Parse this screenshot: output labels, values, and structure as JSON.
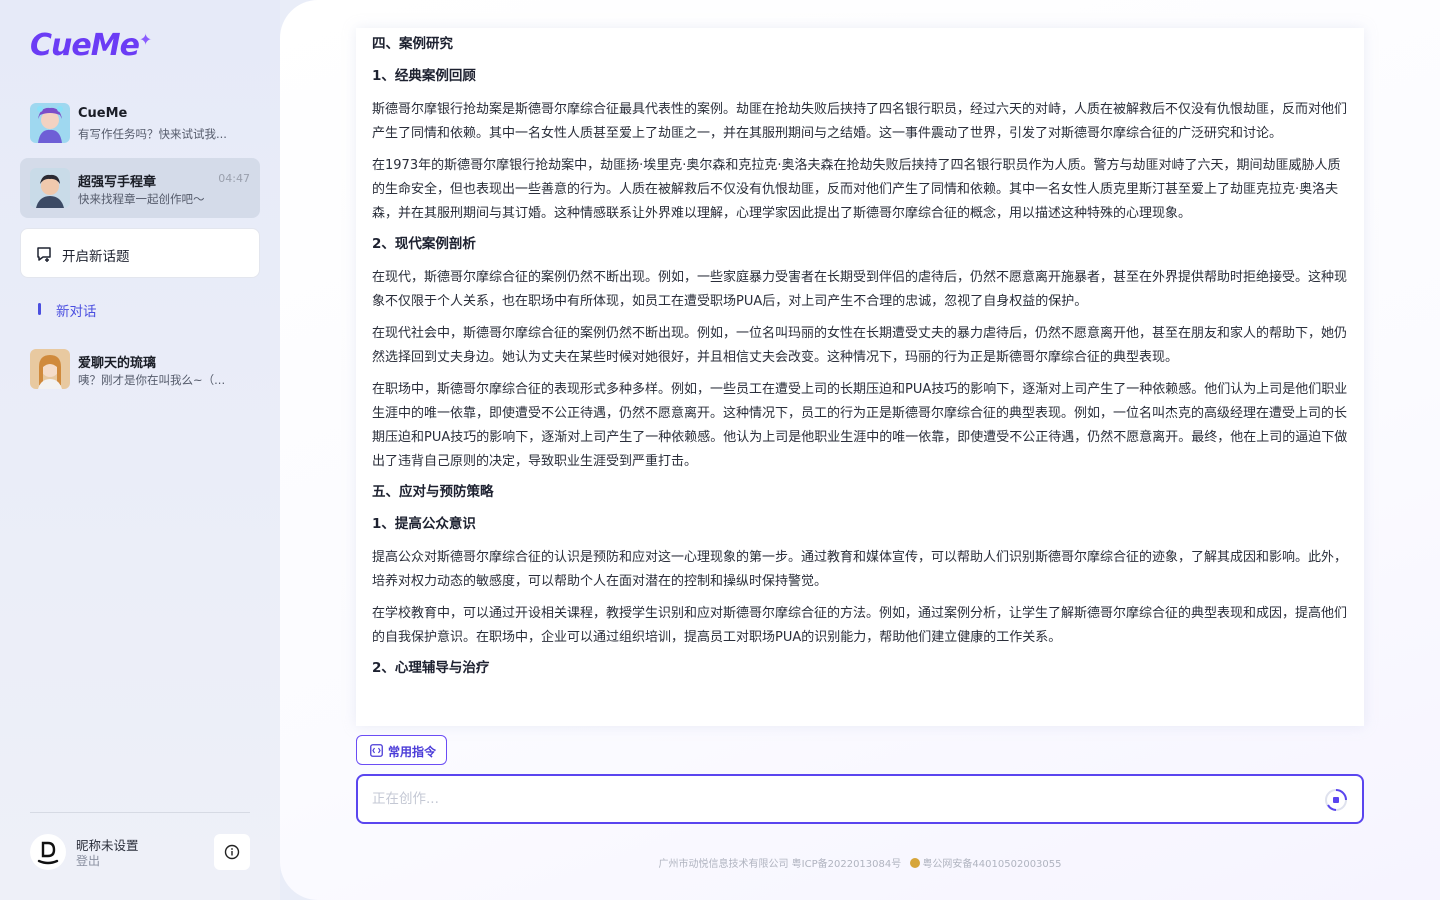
{
  "app": {
    "logo": "CueMe",
    "logo_spark": "✦"
  },
  "sidebar": {
    "chats": [
      {
        "name": "CueMe",
        "subtitle": "有写作任务吗？快来试试我...",
        "time": ""
      },
      {
        "name": "超强写手程章",
        "subtitle": "快来找程章一起创作吧～",
        "time": "04:47"
      }
    ],
    "new_topic_label": "开启新话题",
    "section_label": "新对话",
    "history": [
      {
        "name": "爱聊天的琉璃",
        "subtitle": "咦？刚才是你在叫我么~（..."
      }
    ],
    "user": {
      "name": "昵称未设置",
      "logout": "登出"
    }
  },
  "article": {
    "blocks": [
      {
        "type": "h",
        "text": "四、案例研究"
      },
      {
        "type": "h",
        "text": "1、经典案例回顾"
      },
      {
        "type": "p",
        "text": "斯德哥尔摩银行抢劫案是斯德哥尔摩综合征最具代表性的案例。劫匪在抢劫失败后挟持了四名银行职员，经过六天的对峙，人质在被解救后不仅没有仇恨劫匪，反而对他们产生了同情和依赖。其中一名女性人质甚至爱上了劫匪之一，并在其服刑期间与之结婚。这一事件震动了世界，引发了对斯德哥尔摩综合征的广泛研究和讨论。"
      },
      {
        "type": "p",
        "text": "在1973年的斯德哥尔摩银行抢劫案中，劫匪扬·埃里克·奥尔森和克拉克·奥洛夫森在抢劫失败后挟持了四名银行职员作为人质。警方与劫匪对峙了六天，期间劫匪威胁人质的生命安全，但也表现出一些善意的行为。人质在被解救后不仅没有仇恨劫匪，反而对他们产生了同情和依赖。其中一名女性人质克里斯汀甚至爱上了劫匪克拉克·奥洛夫森，并在其服刑期间与其订婚。这种情感联系让外界难以理解，心理学家因此提出了斯德哥尔摩综合征的概念，用以描述这种特殊的心理现象。"
      },
      {
        "type": "h",
        "text": "2、现代案例剖析"
      },
      {
        "type": "p",
        "text": "在现代，斯德哥尔摩综合征的案例仍然不断出现。例如，一些家庭暴力受害者在长期受到伴侣的虐待后，仍然不愿意离开施暴者，甚至在外界提供帮助时拒绝接受。这种现象不仅限于个人关系，也在职场中有所体现，如员工在遭受职场PUA后，对上司产生不合理的忠诚，忽视了自身权益的保护。"
      },
      {
        "type": "p",
        "text": "在现代社会中，斯德哥尔摩综合征的案例仍然不断出现。例如，一位名叫玛丽的女性在长期遭受丈夫的暴力虐待后，仍然不愿意离开他，甚至在朋友和家人的帮助下，她仍然选择回到丈夫身边。她认为丈夫在某些时候对她很好，并且相信丈夫会改变。这种情况下，玛丽的行为正是斯德哥尔摩综合征的典型表现。"
      },
      {
        "type": "p",
        "text": "在职场中，斯德哥尔摩综合征的表现形式多种多样。例如，一些员工在遭受上司的长期压迫和PUA技巧的影响下，逐渐对上司产生了一种依赖感。他们认为上司是他们职业生涯中的唯一依靠，即使遭受不公正待遇，仍然不愿意离开。这种情况下，员工的行为正是斯德哥尔摩综合征的典型表现。例如，一位名叫杰克的高级经理在遭受上司的长期压迫和PUA技巧的影响下，逐渐对上司产生了一种依赖感。他认为上司是他职业生涯中的唯一依靠，即使遭受不公正待遇，仍然不愿意离开。最终，他在上司的逼迫下做出了违背自己原则的决定，导致职业生涯受到严重打击。"
      },
      {
        "type": "h",
        "text": "五、应对与预防策略"
      },
      {
        "type": "h",
        "text": "1、提高公众意识"
      },
      {
        "type": "p",
        "text": "提高公众对斯德哥尔摩综合征的认识是预防和应对这一心理现象的第一步。通过教育和媒体宣传，可以帮助人们识别斯德哥尔摩综合征的迹象，了解其成因和影响。此外，培养对权力动态的敏感度，可以帮助个人在面对潜在的控制和操纵时保持警觉。"
      },
      {
        "type": "p",
        "text": "在学校教育中，可以通过开设相关课程，教授学生识别和应对斯德哥尔摩综合征的方法。例如，通过案例分析，让学生了解斯德哥尔摩综合征的典型表现和成因，提高他们的自我保护意识。在职场中，企业可以通过组织培训，提高员工对职场PUA的识别能力，帮助他们建立健康的工作关系。"
      },
      {
        "type": "h",
        "text": "2、心理辅导与治疗"
      }
    ]
  },
  "toolbar": {
    "commands_label": "常用指令"
  },
  "input": {
    "placeholder": "正在创作..."
  },
  "footer": {
    "company": "广州市动悦信息技术有限公司 粤ICP备2022013084号",
    "police": "粤公网安备44010502003055"
  },
  "colors": {
    "accent": "#5a45ef",
    "active_item_bg": "#d4dbe9",
    "section_label": "#4b4fe0"
  },
  "icons": [
    "new-topic-icon",
    "info-icon",
    "command-icon",
    "stop-icon",
    "police-emblem-icon"
  ]
}
